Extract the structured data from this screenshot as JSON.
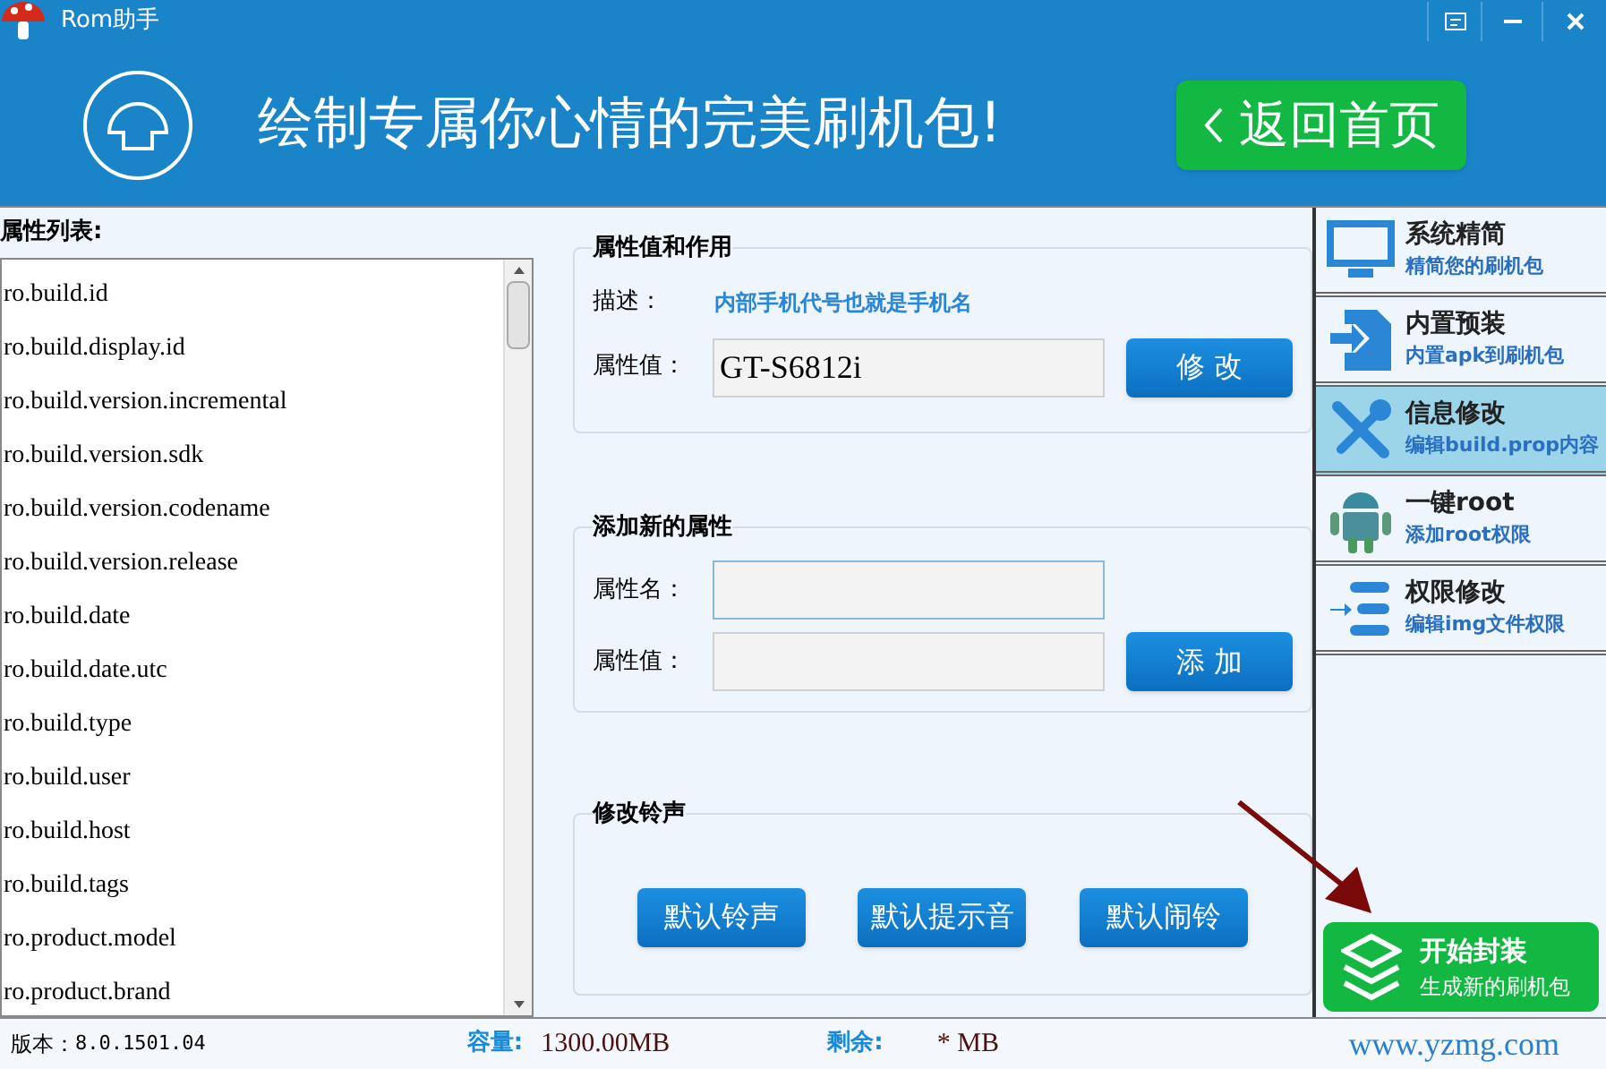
{
  "window": {
    "title": "Rom助手"
  },
  "banner": {
    "slogan": "绘制专属你心情的完美刷机包!",
    "back_button": "返回首页"
  },
  "property_list": {
    "title": "属性列表:",
    "items": [
      "ro.build.id",
      "ro.build.display.id",
      "ro.build.version.incremental",
      "ro.build.version.sdk",
      "ro.build.version.codename",
      "ro.build.version.release",
      "ro.build.date",
      "ro.build.date.utc",
      "ro.build.type",
      "ro.build.user",
      "ro.build.host",
      "ro.build.tags",
      "ro.product.model",
      "ro.product.brand"
    ]
  },
  "value_group": {
    "title": "属性值和作用",
    "desc_label": "描述：",
    "desc": "内部手机代号也就是手机名",
    "value_label": "属性值：",
    "value": "GT-S6812i",
    "button": "修 改"
  },
  "add_group": {
    "title": "添加新的属性",
    "name_label": "属性名：",
    "value_label": "属性值：",
    "button": "添 加"
  },
  "ringtone_group": {
    "title": "修改铃声",
    "buttons": [
      "默认铃声",
      "默认提示音",
      "默认闹铃"
    ]
  },
  "sidebar": {
    "items": [
      {
        "kind": "monitor",
        "title": "系统精简",
        "subtitle": "精简您的刷机包",
        "selected": false
      },
      {
        "kind": "import",
        "title": "内置预装",
        "subtitle": "内置apk到刷机包",
        "selected": false
      },
      {
        "kind": "tools",
        "title": "信息修改",
        "subtitle": "编辑build.prop内容",
        "selected": true
      },
      {
        "kind": "android",
        "title": "一键root",
        "subtitle": "添加root权限",
        "selected": false
      },
      {
        "kind": "list",
        "title": "权限修改",
        "subtitle": "编辑img文件权限",
        "selected": false
      }
    ],
    "pack_button": {
      "title": "开始封装",
      "subtitle": "生成新的刷机包"
    }
  },
  "status_bar": {
    "version_label": "版本：",
    "version": "8.0.1501.04",
    "capacity_label": "容量:",
    "capacity": "1300.00MB",
    "remaining_label": "剩余:",
    "remaining": "* MB",
    "website": "www.yzmg.com"
  }
}
